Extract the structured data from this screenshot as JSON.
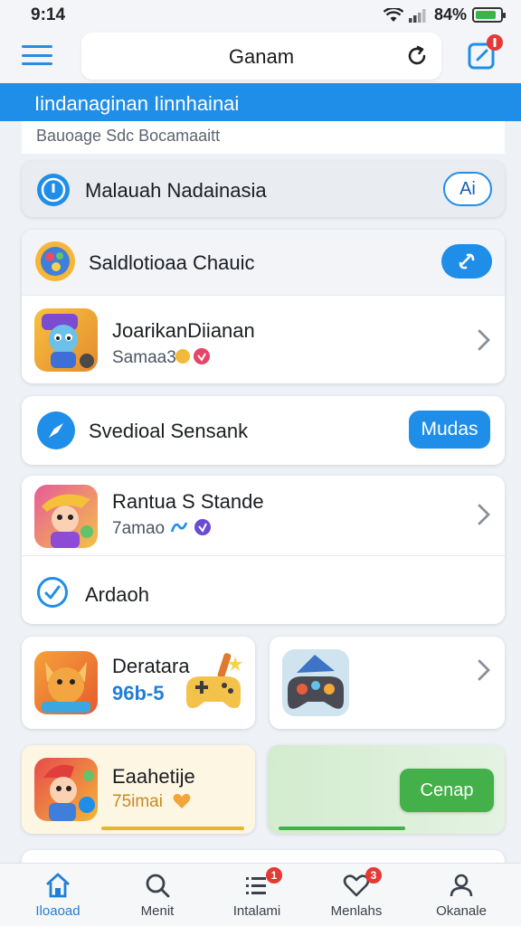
{
  "status": {
    "time": "9:14",
    "battery_pct": "84%"
  },
  "header": {
    "title": "Ganam",
    "notif_count": ""
  },
  "banner": {
    "title": "Iindanaginan  Iinnhainai",
    "subtitle": "Bauoage Sdc  Bocamaaitt"
  },
  "rows": {
    "malauah": {
      "label": "Malauah Nadainasia",
      "button": "Ai"
    },
    "saldlotioaa": {
      "label": "Saldlotioaa Chauic"
    },
    "app1": {
      "title": "JoarikanDiianan",
      "sub": "Samaa3"
    },
    "svedioal": {
      "label": "Svedioal Sensank",
      "button": "Mudas"
    },
    "app2": {
      "title": "Rantua S Stande",
      "sub": "7amao"
    },
    "ardaoh": {
      "label": "Ardaoh"
    },
    "tile1": {
      "title": "Deratara",
      "value": "96b-5"
    },
    "tile3": {
      "title": "Eaahetije",
      "sub": "75imai"
    },
    "tile4": {
      "button": "Cenap"
    }
  },
  "nav": [
    {
      "label": "Iloaoad",
      "icon": "home-icon",
      "badge": ""
    },
    {
      "label": "Menit",
      "icon": "search-icon",
      "badge": ""
    },
    {
      "label": "Intalami",
      "icon": "list-icon",
      "badge": "1"
    },
    {
      "label": "Menlahs",
      "icon": "heart-icon",
      "badge": "3"
    },
    {
      "label": "Okanale",
      "icon": "profile-icon",
      "badge": ""
    }
  ],
  "colors": {
    "accent": "#1f8ee8",
    "green": "#43b04a",
    "badge": "#e53935"
  }
}
